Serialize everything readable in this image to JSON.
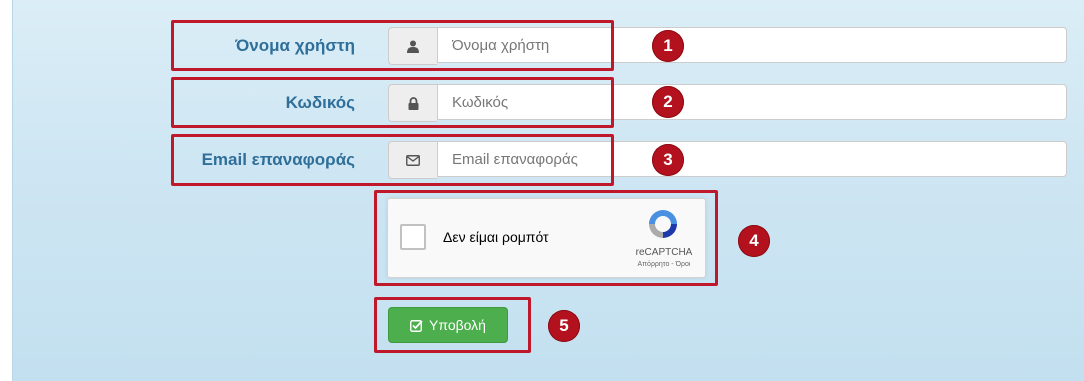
{
  "form": {
    "username": {
      "label": "Όνομα χρήστη",
      "placeholder": "Όνομα χρήστη",
      "icon": "user-icon"
    },
    "password": {
      "label": "Κωδικός",
      "placeholder": "Κωδικός",
      "icon": "lock-icon"
    },
    "email": {
      "label": "Email επαναφοράς",
      "placeholder": "Email επαναφοράς",
      "icon": "envelope-icon"
    }
  },
  "captcha": {
    "checkbox_label": "Δεν είμαι ρομπότ",
    "brand": "reCAPTCHA",
    "terms": "Απόρρητο - Όροι"
  },
  "submit": {
    "label": "Υποβολή",
    "icon": "check-square-icon"
  },
  "callouts": [
    "1",
    "2",
    "3",
    "4",
    "5"
  ],
  "colors": {
    "highlight": "#c0182b",
    "badge": "#b3111d",
    "label": "#2f6f99",
    "submit": "#4cae4c"
  }
}
